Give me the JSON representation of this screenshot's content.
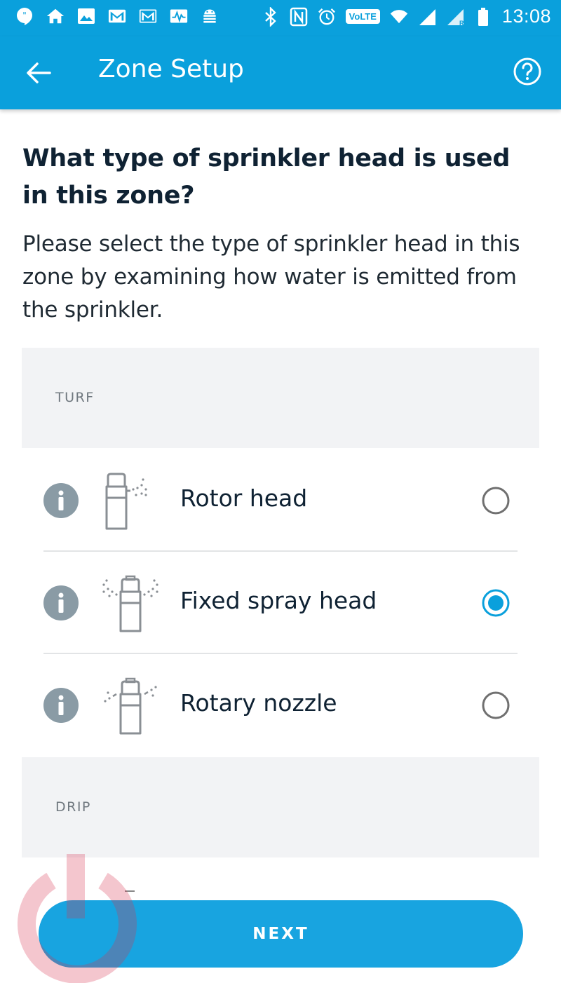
{
  "status_bar": {
    "time": "13:08",
    "volte": "VoLTE",
    "left_icons": [
      "hangouts-icon",
      "home-icon",
      "image-icon",
      "gmail-icon",
      "gmail-icon",
      "activity-icon",
      "android-debug-icon"
    ],
    "right_icons": [
      "bluetooth-icon",
      "nfc-icon",
      "alarm-icon",
      "volte-icon",
      "wifi-icon",
      "signal-icon",
      "signal-roaming-icon",
      "battery-icon"
    ]
  },
  "app_bar": {
    "title": "Zone Setup",
    "back_icon": "arrow-back-icon",
    "help_icon": "help-circle-icon",
    "color": "#0aa0dc"
  },
  "question": "What type of sprinkler head is used in this zone?",
  "description": "Please select the type of sprinkler head in this zone by examining how water is emitted from the sprinkler.",
  "sections": [
    {
      "label": "TURF",
      "options": [
        {
          "label": "Rotor head",
          "icon": "rotor-head-icon",
          "selected": false
        },
        {
          "label": "Fixed spray head",
          "icon": "fixed-spray-head-icon",
          "selected": true
        },
        {
          "label": "Rotary nozzle",
          "icon": "rotary-nozzle-icon",
          "selected": false
        }
      ]
    },
    {
      "label": "DRIP",
      "options": []
    }
  ],
  "next_button": {
    "label": "NEXT"
  },
  "colors": {
    "accent": "#0aa0dc",
    "button": "#18a4e0",
    "section_bg": "#f2f3f5",
    "info_icon": "#8a9ba5",
    "radio_selected": "#0aa0dc",
    "radio_unselected": "#707070"
  }
}
